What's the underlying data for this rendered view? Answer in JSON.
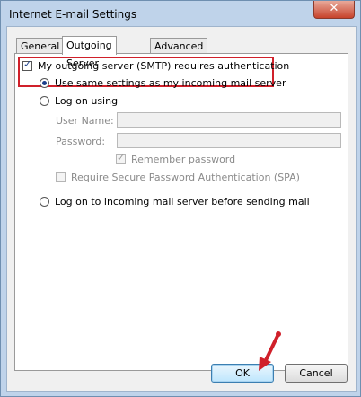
{
  "window": {
    "title": "Internet E-mail Settings",
    "close_glyph": "✕"
  },
  "tabs": [
    {
      "label": "General",
      "active": false
    },
    {
      "label": "Outgoing Server",
      "active": true
    },
    {
      "label": "Advanced",
      "active": false
    }
  ],
  "outgoing": {
    "requires_auth_label": "My outgoing server (SMTP) requires authentication",
    "requires_auth_checked": true,
    "same_settings_label": "Use same settings as my incoming mail server",
    "same_settings_selected": true,
    "log_on_using_label": "Log on using",
    "user_name_label": "User Name:",
    "user_name_value": "",
    "password_label": "Password:",
    "password_value": "",
    "remember_password_label": "Remember password",
    "remember_password_checked": true,
    "spa_label": "Require Secure Password Authentication (SPA)",
    "spa_checked": false,
    "log_on_incoming_label": "Log on to incoming mail server before sending mail"
  },
  "buttons": {
    "ok_label": "OK",
    "cancel_label": "Cancel"
  },
  "colors": {
    "highlight": "#d0202a",
    "arrow": "#d0202a"
  }
}
